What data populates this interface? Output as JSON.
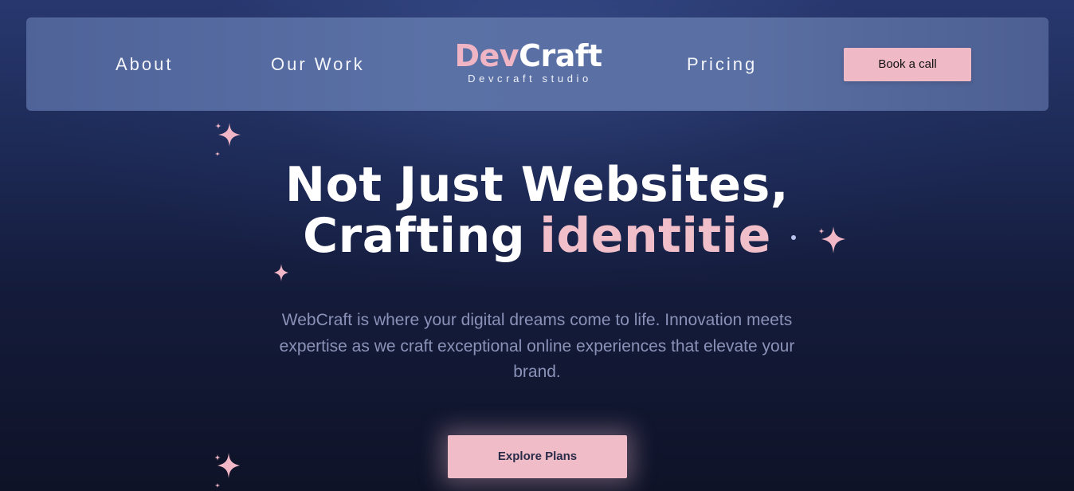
{
  "nav": {
    "about": "About",
    "our_work": "Our Work",
    "pricing": "Pricing",
    "book_call": "Book a call"
  },
  "logo": {
    "dev": "Dev",
    "craft": "Craft",
    "tagline": "Devcraft studio"
  },
  "hero": {
    "title_line1": "Not Just Websites,",
    "title_line2_prefix": "Crafting",
    "title_line2_accent": "identitie",
    "description": "WebCraft is where your digital dreams come to life. Innovation meets expertise as we craft exceptional online experiences that elevate your brand.",
    "cta": "Explore Plans"
  },
  "decorations": {
    "sparkle_icon": "sparkle-icon",
    "dot_icon": "star-dot-icon"
  },
  "colors": {
    "accent_pink": "#efbac6",
    "navbar_blue": "#5a71a6",
    "background_dark": "#141b3a",
    "body_text_muted": "#8b92b8"
  }
}
